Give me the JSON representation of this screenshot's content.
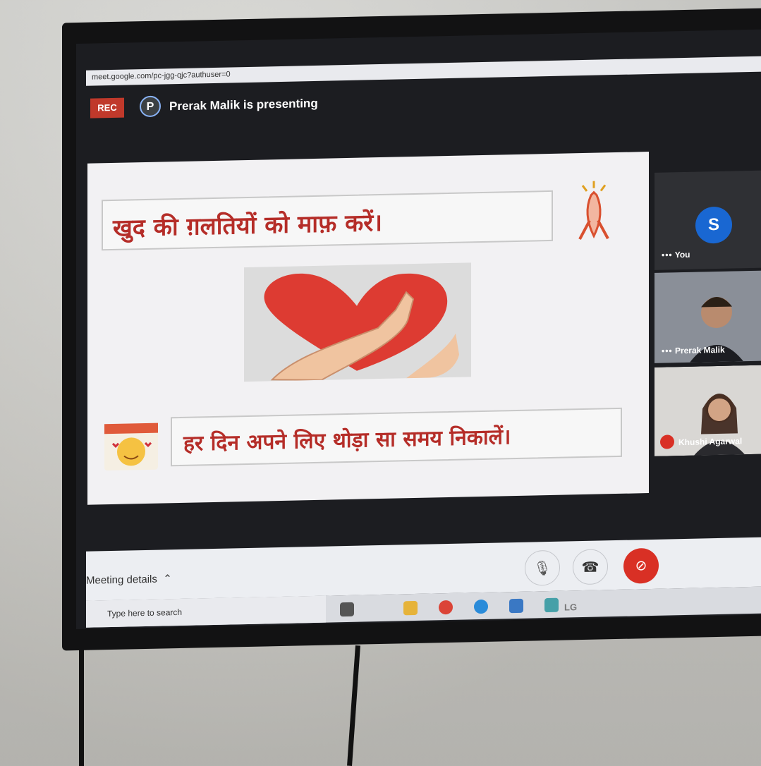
{
  "browser": {
    "url": "meet.google.com/pc-jgg-qjc?authuser=0"
  },
  "header": {
    "rec_label": "REC",
    "presenter_initial": "P",
    "presenting_text": "Prerak Malik is presenting"
  },
  "slide": {
    "line1": "खुद की ग़लतियों को माफ़ करें।",
    "line2": "हर दिन अपने लिए थोड़ा सा समय निकालें।"
  },
  "participants": [
    {
      "name": "You",
      "initial": "S",
      "mic": "on"
    },
    {
      "name": "Prerak Malik",
      "mic": "on"
    },
    {
      "name": "Khushi Agarwal",
      "mic": "muted"
    }
  ],
  "controls": {
    "meeting_details": "Meeting details",
    "mic_icon": "mic-icon",
    "hangup_icon": "hangup-icon",
    "camera_icon": "camera-off-icon"
  },
  "taskbar": {
    "search_placeholder": "Type here to search"
  },
  "tv": {
    "brand": "LG"
  },
  "colors": {
    "accent_red": "#d93025",
    "hindi_red": "#b52d28",
    "avatar_blue": "#1967d2"
  }
}
